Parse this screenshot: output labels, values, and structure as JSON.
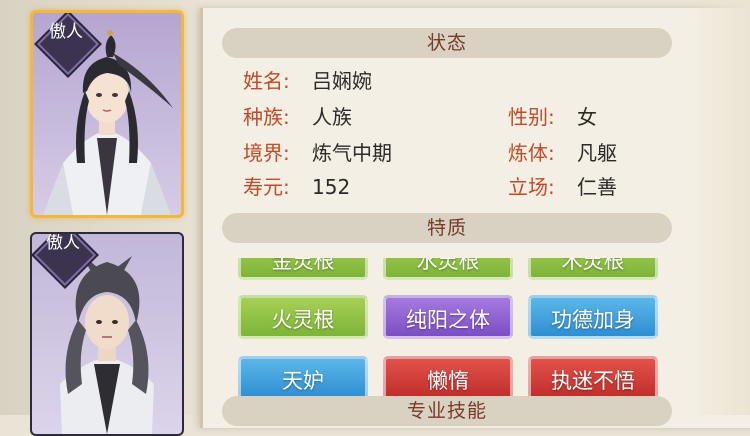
{
  "roster": {
    "cards": [
      {
        "rank": "傲人",
        "selected": true
      },
      {
        "rank": "傲人",
        "selected": false
      }
    ]
  },
  "sections": {
    "status": "状态",
    "traits": "特质",
    "skills": "专业技能"
  },
  "status": {
    "name_label": "姓名:",
    "name": "吕娴婉",
    "race_label": "种族:",
    "race": "人族",
    "gender_label": "性别:",
    "gender": "女",
    "realm_label": "境界:",
    "realm": "炼气中期",
    "body_label": "炼体:",
    "body": "凡躯",
    "lifespan_label": "寿元:",
    "lifespan": "152",
    "stance_label": "立场:",
    "stance": "仁善"
  },
  "traits": [
    {
      "label": "金灵根",
      "color": "green"
    },
    {
      "label": "水灵根",
      "color": "green"
    },
    {
      "label": "木灵根",
      "color": "green"
    },
    {
      "label": "火灵根",
      "color": "green"
    },
    {
      "label": "纯阳之体",
      "color": "purple"
    },
    {
      "label": "功德加身",
      "color": "blue"
    },
    {
      "label": "天妒",
      "color": "blue"
    },
    {
      "label": "懒惰",
      "color": "red"
    },
    {
      "label": "执迷不悟",
      "color": "red"
    }
  ],
  "colors": {
    "label_red": "#c24a26",
    "header_text": "#7a3a28",
    "selected_border": "#f3b73e"
  }
}
